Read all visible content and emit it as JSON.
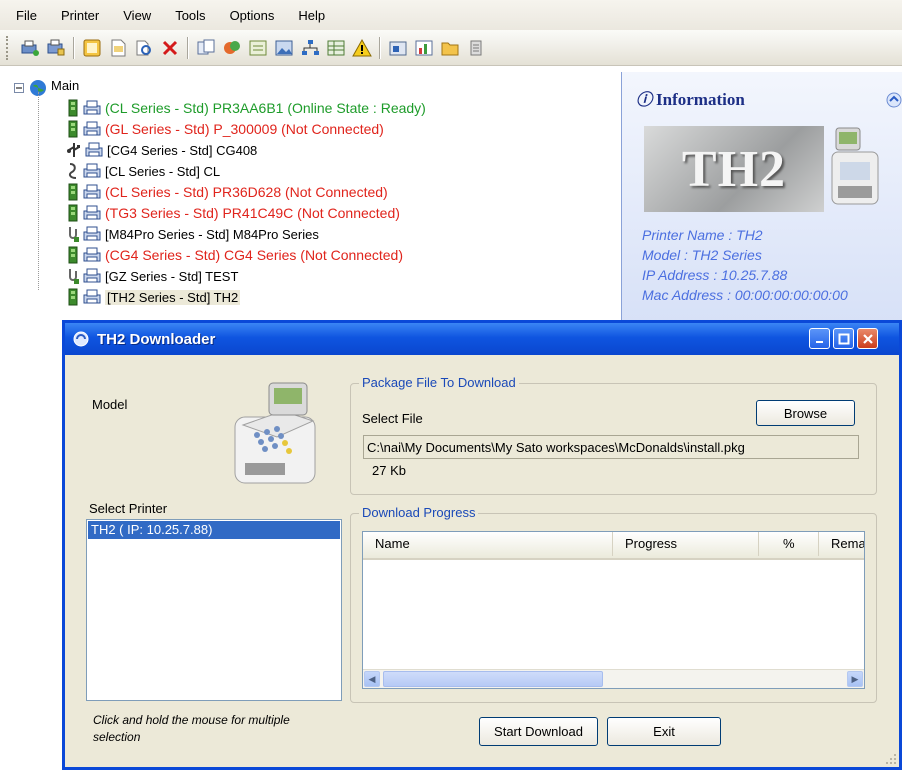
{
  "menu": [
    "File",
    "Printer",
    "View",
    "Tools",
    "Options",
    "Help"
  ],
  "toolbar_icons": [
    "add-printer-icon",
    "printer-settings-icon",
    "sep",
    "open-file-icon",
    "page-icon",
    "find-icon",
    "delete-icon",
    "sep",
    "copy-icon",
    "paint-icon",
    "form-icon",
    "image-icon",
    "network-icon",
    "grid-icon",
    "warning-icon",
    "sep",
    "download-icon",
    "chart-icon",
    "folder-icon",
    "list-icon"
  ],
  "tree": {
    "root": "Main",
    "items": [
      {
        "label": "(CL Series - Std) PR3AA6B1 (Online State : Ready)",
        "status": "green",
        "conn": "network"
      },
      {
        "label": "(GL Series - Std) P_300009 (Not Connected)",
        "status": "red",
        "conn": "network"
      },
      {
        "label": "[CG4 Series - Std] CG408",
        "status": "black",
        "conn": "usb"
      },
      {
        "label": "[CL Series - Std] CL",
        "status": "black",
        "conn": "serial"
      },
      {
        "label": "(CL Series - Std) PR36D628 (Not Connected)",
        "status": "red",
        "conn": "network"
      },
      {
        "label": "(TG3 Series - Std) PR41C49C (Not Connected)",
        "status": "red",
        "conn": "network"
      },
      {
        "label": "[M84Pro Series - Std] M84Pro Series",
        "status": "black",
        "conn": "parallel"
      },
      {
        "label": "(CG4 Series - Std) CG4 Series (Not Connected)",
        "status": "red",
        "conn": "network"
      },
      {
        "label": "[GZ Series - Std] TEST",
        "status": "black",
        "conn": "parallel"
      },
      {
        "label": "[TH2 Series - Std] TH2",
        "status": "black",
        "conn": "network"
      }
    ]
  },
  "info": {
    "title": "Information",
    "logo_text": "TH2",
    "printer_name": "Printer Name : TH2",
    "model": "Model : TH2 Series",
    "ip": "IP Address : 10.25.7.88",
    "mac": "Mac Address : 00:00:00:00:00:00"
  },
  "dialog": {
    "title": "TH2 Downloader",
    "model_label": "Model",
    "package_group": "Package File To Download",
    "select_file_label": "Select File",
    "browse": "Browse",
    "file_path": "C:\\nai\\My Documents\\My Sato workspaces\\McDonalds\\install.pkg",
    "file_size": "27 Kb",
    "select_printer_label": "Select Printer",
    "printers": [
      "TH2 ( IP: 10.25.7.88)"
    ],
    "progress_group": "Download Progress",
    "columns": [
      "Name",
      "Progress",
      "%",
      "Rema"
    ],
    "hint_line1": "Click and hold the mouse for multiple",
    "hint_line2": "selection",
    "start": "Start Download",
    "exit": "Exit"
  },
  "colors": {
    "online": "#1e9c2a",
    "offline": "#e0241c",
    "titlebar": "#0a46cf",
    "info_text": "#4b6fe0"
  }
}
